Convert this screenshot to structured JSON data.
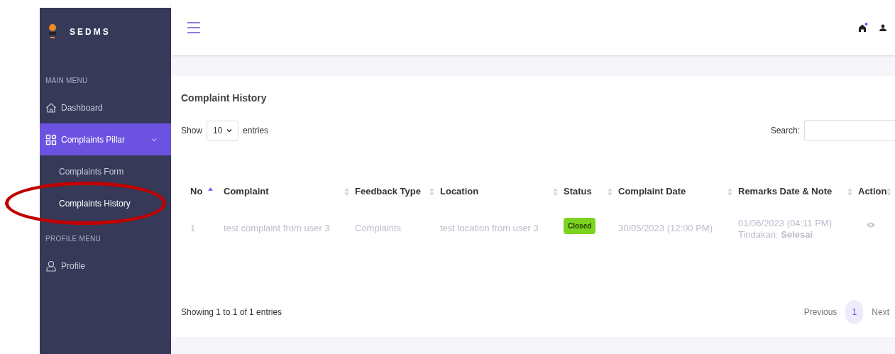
{
  "sidebar": {
    "brand": "SEDMS",
    "sections": [
      {
        "title": "MAIN MENU",
        "items": [
          {
            "label": "Dashboard",
            "selected": false
          },
          {
            "label": "Complaints Pillar",
            "selected": true,
            "expanded": true,
            "children": [
              {
                "label": "Complaints Form",
                "selected": false
              },
              {
                "label": "Complaints History",
                "selected": true
              }
            ]
          }
        ]
      },
      {
        "title": "PROFILE MENU",
        "items": [
          {
            "label": "Profile",
            "selected": false
          }
        ]
      }
    ]
  },
  "header": {
    "notification": true
  },
  "card": {
    "title": "Complaint History",
    "length": {
      "before": "Show",
      "value": "10",
      "after": "entries"
    },
    "search": {
      "label": "Search:"
    },
    "table": {
      "columns": [
        {
          "label": "No",
          "sorted": true
        },
        {
          "label": "Complaint",
          "sorted": false
        },
        {
          "label": "Feedback Type",
          "sorted": false
        },
        {
          "label": "Location",
          "sorted": false
        },
        {
          "label": "Status",
          "sorted": false
        },
        {
          "label": "Complaint Date",
          "sorted": false
        },
        {
          "label": "Remarks Date & Note",
          "sorted": false
        },
        {
          "label": "Action",
          "sorted": false
        }
      ],
      "rows": [
        {
          "no": "1",
          "complaint": "test complaint from user 3",
          "feedback_type": "Complaints",
          "location": "test location from user 3",
          "status": {
            "label": "Closed",
            "color": "#7ed321"
          },
          "complaint_date": "30/05/2023 (12:00 PM)",
          "remarks": [
            "01/06/2023 (04:11 PM)",
            "Tindakan: **Selesai**"
          ]
        }
      ]
    },
    "info": "Showing 1 to 1 of 1 entries",
    "pagination": {
      "previous": "Previous",
      "pages": [
        {
          "label": "1",
          "selected": true
        }
      ],
      "next": "Next"
    }
  },
  "annotation": {
    "highlight": true
  }
}
